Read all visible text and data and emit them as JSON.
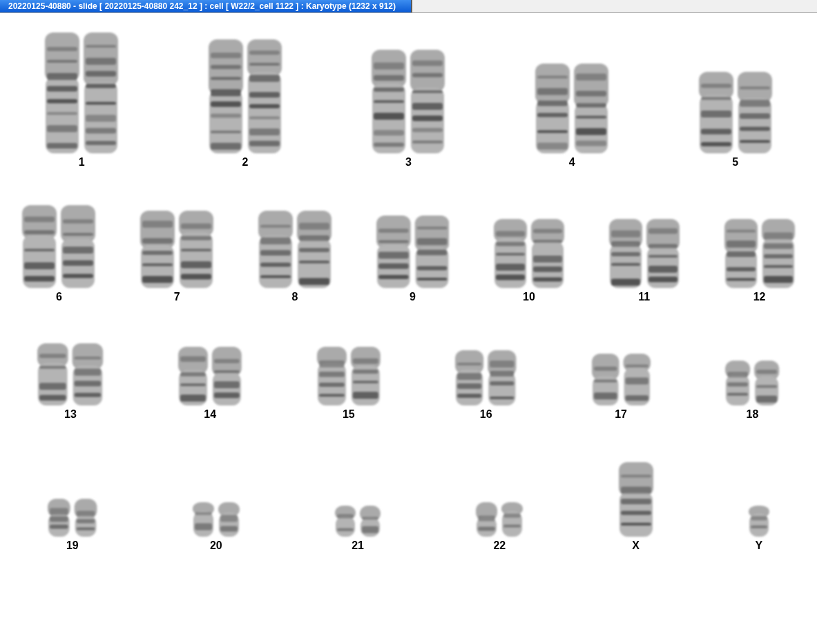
{
  "window": {
    "title": "20220125-40880 - slide [ 20220125-40880 242_12 ] : cell [ W22/2_cell 1122 ] : Karyotype  (1232 x 912)"
  },
  "karyotype": {
    "rows": [
      [
        {
          "label": "1",
          "kind": "pair"
        },
        {
          "label": "2",
          "kind": "pair"
        },
        {
          "label": "3",
          "kind": "pair"
        },
        {
          "label": "4",
          "kind": "pair"
        },
        {
          "label": "5",
          "kind": "pair"
        }
      ],
      [
        {
          "label": "6",
          "kind": "pair"
        },
        {
          "label": "7",
          "kind": "pair"
        },
        {
          "label": "8",
          "kind": "pair"
        },
        {
          "label": "9",
          "kind": "pair"
        },
        {
          "label": "10",
          "kind": "pair"
        },
        {
          "label": "11",
          "kind": "pair"
        },
        {
          "label": "12",
          "kind": "pair"
        }
      ],
      [
        {
          "label": "13",
          "kind": "pair"
        },
        {
          "label": "14",
          "kind": "pair"
        },
        {
          "label": "15",
          "kind": "pair"
        },
        {
          "label": "16",
          "kind": "pair"
        },
        {
          "label": "17",
          "kind": "pair"
        },
        {
          "label": "18",
          "kind": "pair"
        }
      ],
      [
        {
          "label": "19",
          "kind": "pair"
        },
        {
          "label": "20",
          "kind": "pair"
        },
        {
          "label": "21",
          "kind": "pair"
        },
        {
          "label": "22",
          "kind": "pair"
        },
        {
          "label": "X",
          "kind": "single"
        },
        {
          "label": "Y",
          "kind": "single"
        }
      ]
    ]
  }
}
